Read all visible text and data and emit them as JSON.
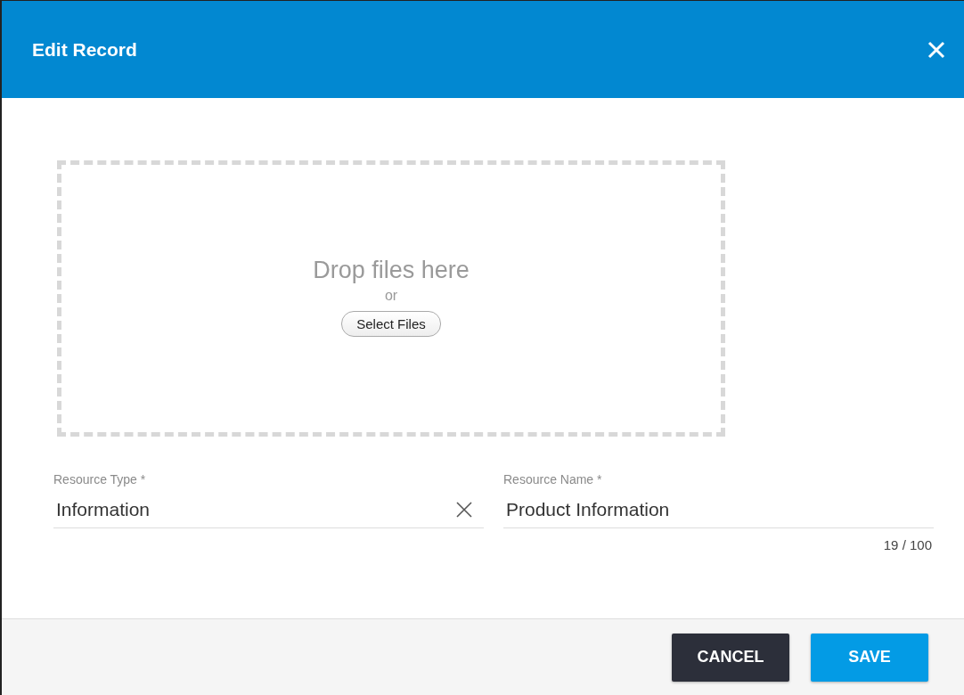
{
  "dialog": {
    "title": "Edit Record"
  },
  "dropzone": {
    "prompt": "Drop files here",
    "separator": "or",
    "button": "Select Files"
  },
  "fields": [
    {
      "label": "Resource Type *",
      "value": "Information",
      "clearable": true
    },
    {
      "label": "Resource Name *",
      "value": "Product Information",
      "counter": "19 / 100"
    }
  ],
  "buttons": [
    {
      "kind": "secondary",
      "label": "CANCEL"
    },
    {
      "kind": "primary",
      "label": "SAVE"
    }
  ]
}
